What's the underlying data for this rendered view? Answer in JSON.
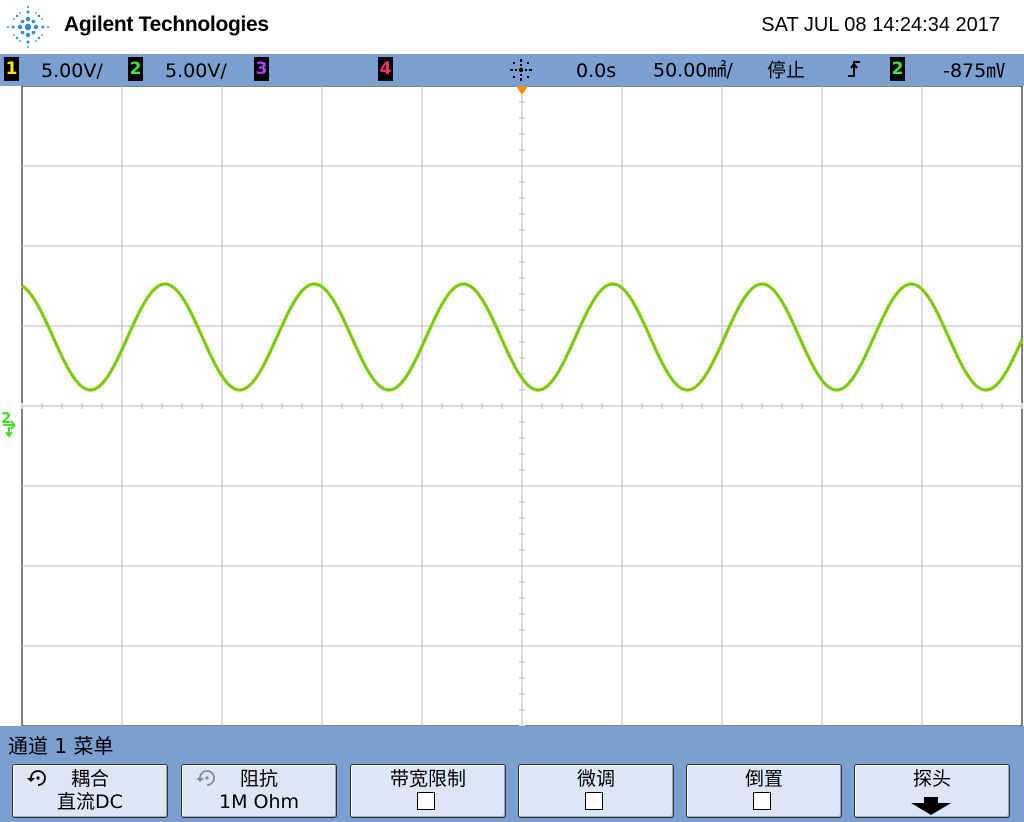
{
  "header": {
    "brand": "Agilent Technologies",
    "datetime": "SAT JUL 08 14:24:34 2017"
  },
  "status": {
    "ch1": {
      "num": "1",
      "scale": "5.00V/"
    },
    "ch2": {
      "num": "2",
      "scale": "5.00V/"
    },
    "ch3": {
      "num": "3"
    },
    "ch4": {
      "num": "4"
    },
    "delay": "0.0s",
    "timebase": "50.00㎟/",
    "run_state": "停止",
    "trigger_source": "2",
    "trigger_level": "-875㎷"
  },
  "waveform": {
    "ground_marker_label": "2",
    "cycles_visible": 6.7,
    "colors": {
      "ch1": "#f2b51a",
      "ch2": "#44dd22"
    }
  },
  "menu": {
    "title": "通道 1  菜单",
    "softkeys": [
      {
        "line1": "耦合",
        "line2": "直流DC"
      },
      {
        "line1": "阻抗",
        "line2": "1M Ohm"
      },
      {
        "line1": "带宽限制"
      },
      {
        "line1": "微调"
      },
      {
        "line1": "倒置"
      },
      {
        "line1": "探头"
      }
    ]
  },
  "colors": {
    "bar_bg": "#7a9fd0",
    "softkey_bg": "#dde6f5",
    "grid": "#b8b8b8"
  }
}
